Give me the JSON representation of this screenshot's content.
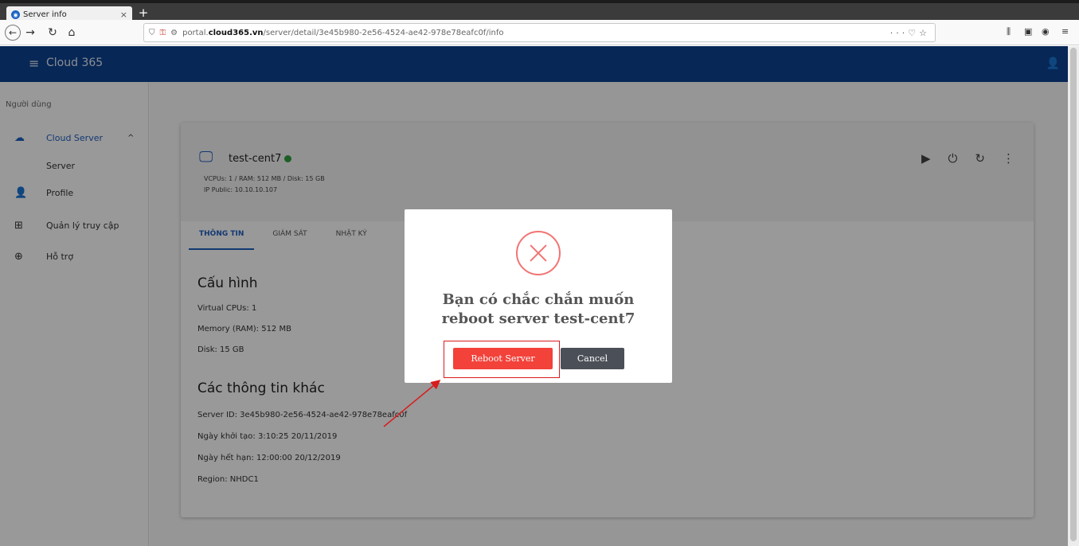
{
  "browser": {
    "tab_title": "Server info",
    "tab_close": "×",
    "new_tab": "+",
    "url_prefix": "portal.",
    "url_domain": "cloud365.vn",
    "url_path": "/server/detail/3e45b980-2e56-4524-ae42-978e78eafc0f/info",
    "url_more": "···",
    "favicon": "globe-icon"
  },
  "app": {
    "brand": "Cloud 365"
  },
  "sidebar": {
    "section": "Người dùng",
    "items": [
      {
        "label": "Cloud Server",
        "icon": "cloud-icon"
      },
      {
        "label": "Profile",
        "icon": "person-icon"
      },
      {
        "label": "Quản lý truy cập",
        "icon": "access-icon"
      },
      {
        "label": "Hỗ trợ",
        "icon": "support-icon"
      }
    ],
    "subitem": "Server"
  },
  "server": {
    "name": "test-cent7",
    "specs": "VCPUs: 1 / RAM: 512 MB / Disk: 15 GB",
    "ip": "IP Public:  10.10.10.107",
    "status_color": "#2e9e3f"
  },
  "tabs": [
    "THÔNG TIN",
    "GIÁM SÁT",
    "NHẬT KÝ"
  ],
  "config": {
    "title": "Cấu hình",
    "lines": [
      "Virtual CPUs: 1",
      "Memory (RAM): 512 MB",
      "Disk: 15 GB"
    ]
  },
  "other": {
    "title": "Các thông tin khác",
    "lines": [
      "Server ID: 3e45b980-2e56-4524-ae42-978e78eafc0f",
      "Ngày khởi tạo: 3:10:25 20/11/2019",
      "Ngày hết hạn: 12:00:00 20/12/2019",
      "Region: NHDC1"
    ]
  },
  "modal": {
    "title_line1": "Bạn có chắc chắn muốn",
    "title_line2": "reboot server test-cent7",
    "confirm_label": "Reboot Server",
    "cancel_label": "Cancel",
    "confirm_color": "#f2423a",
    "icon": "error-x-icon"
  },
  "colors": {
    "appbar": "#0d4190",
    "accent": "#1f5fbf",
    "annotation": "#d91c1c"
  }
}
